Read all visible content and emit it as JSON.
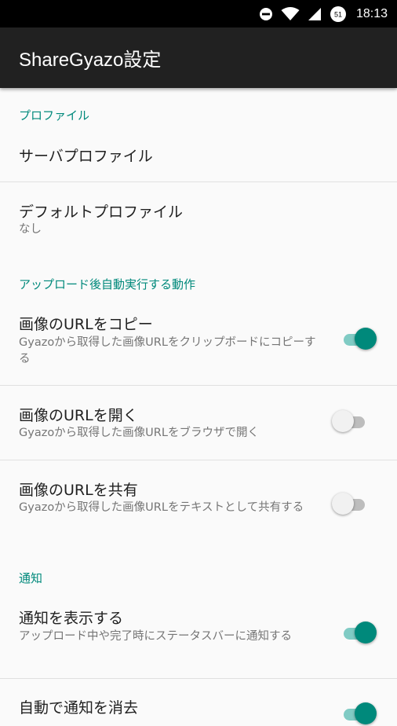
{
  "status_bar": {
    "time": "18:13",
    "icons": [
      "do-not-disturb-icon",
      "wifi-icon",
      "signal-icon",
      "battery-icon"
    ],
    "battery_level": "51"
  },
  "app_bar": {
    "title": "ShareGyazo設定"
  },
  "sections": {
    "profile": {
      "header": "プロファイル"
    },
    "after_upload": {
      "header": "アップロード後自動実行する動作"
    },
    "notification": {
      "header": "通知"
    }
  },
  "settings": {
    "server_profile": {
      "title": "サーバプロファイル"
    },
    "default_profile": {
      "title": "デフォルトプロファイル",
      "summary": "なし"
    },
    "copy_url": {
      "title": "画像のURLをコピー",
      "summary": "Gyazoから取得した画像URLをクリップボードにコピーする",
      "enabled": true
    },
    "open_url": {
      "title": "画像のURLを開く",
      "summary": "Gyazoから取得した画像URLをブラウザで開く",
      "enabled": false
    },
    "share_url": {
      "title": "画像のURLを共有",
      "summary": "Gyazoから取得した画像URLをテキストとして共有する",
      "enabled": false
    },
    "show_notification": {
      "title": "通知を表示する",
      "summary": "アップロード中や完了時にステータスバーに通知する",
      "enabled": true
    },
    "auto_dismiss": {
      "title": "自動で通知を消去",
      "enabled": true
    }
  },
  "colors": {
    "accent": "#00897b",
    "app_bar": "#212121",
    "status_bar": "#000000"
  }
}
